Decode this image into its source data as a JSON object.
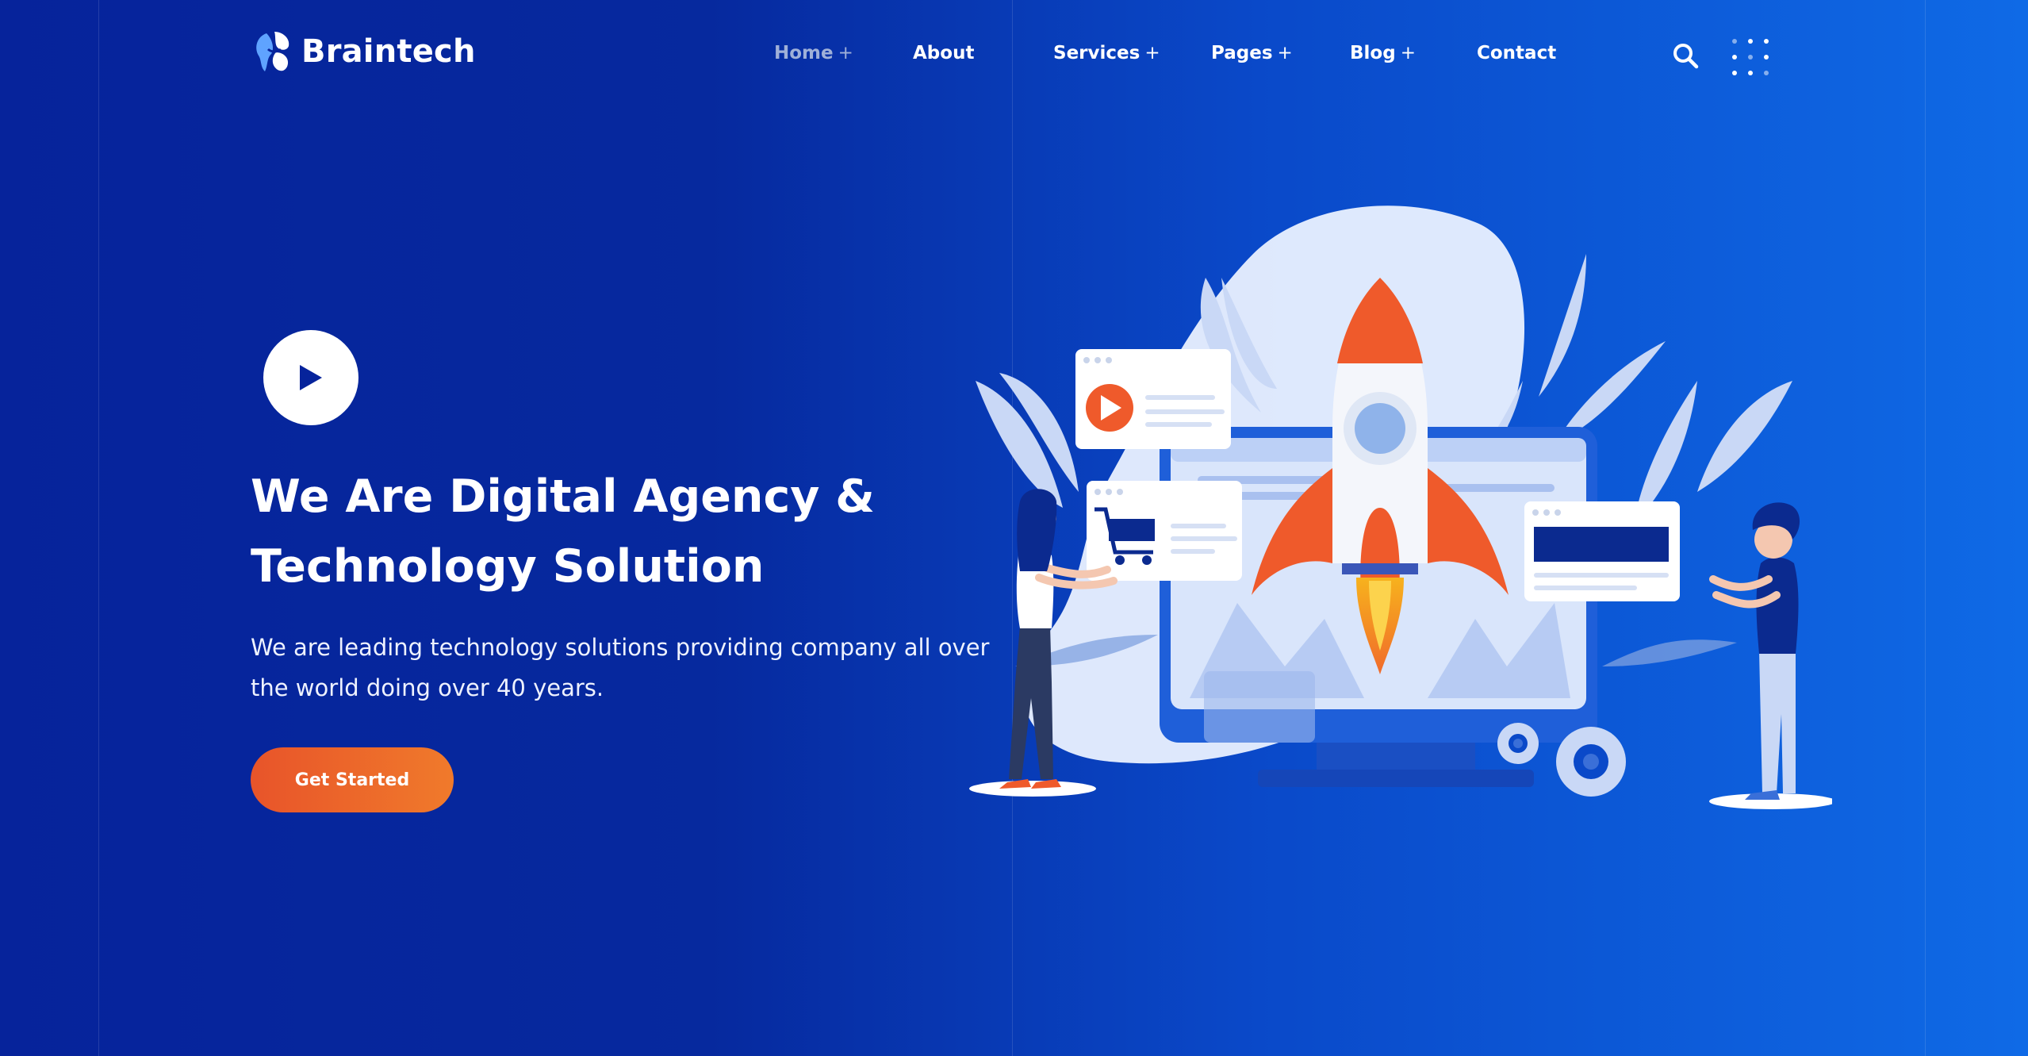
{
  "brand": {
    "name": "Braintech",
    "icon": "braintech-logo-icon"
  },
  "nav": {
    "items": [
      {
        "label": "Home",
        "suffix": "+",
        "active": true
      },
      {
        "label": "About",
        "suffix": ""
      },
      {
        "label": "Services",
        "suffix": "+"
      },
      {
        "label": "Pages",
        "suffix": "+"
      },
      {
        "label": "Blog",
        "suffix": "+"
      },
      {
        "label": "Contact",
        "suffix": ""
      }
    ],
    "search_icon": "search-icon",
    "menu_icon": "dots-grid-icon"
  },
  "hero": {
    "play_icon": "play-icon",
    "title_line1": "We Are Digital Agency &",
    "title_line2": "Technology Solution",
    "subtitle": "We are leading technology solutions providing company all over the world doing over 40 years.",
    "cta_label": "Get Started"
  },
  "colors": {
    "background_start": "#06239b",
    "background_end": "#0f6ae6",
    "accent_orange": "#e8542a",
    "nav_active": "#9fb0d8",
    "text": "#ffffff"
  }
}
